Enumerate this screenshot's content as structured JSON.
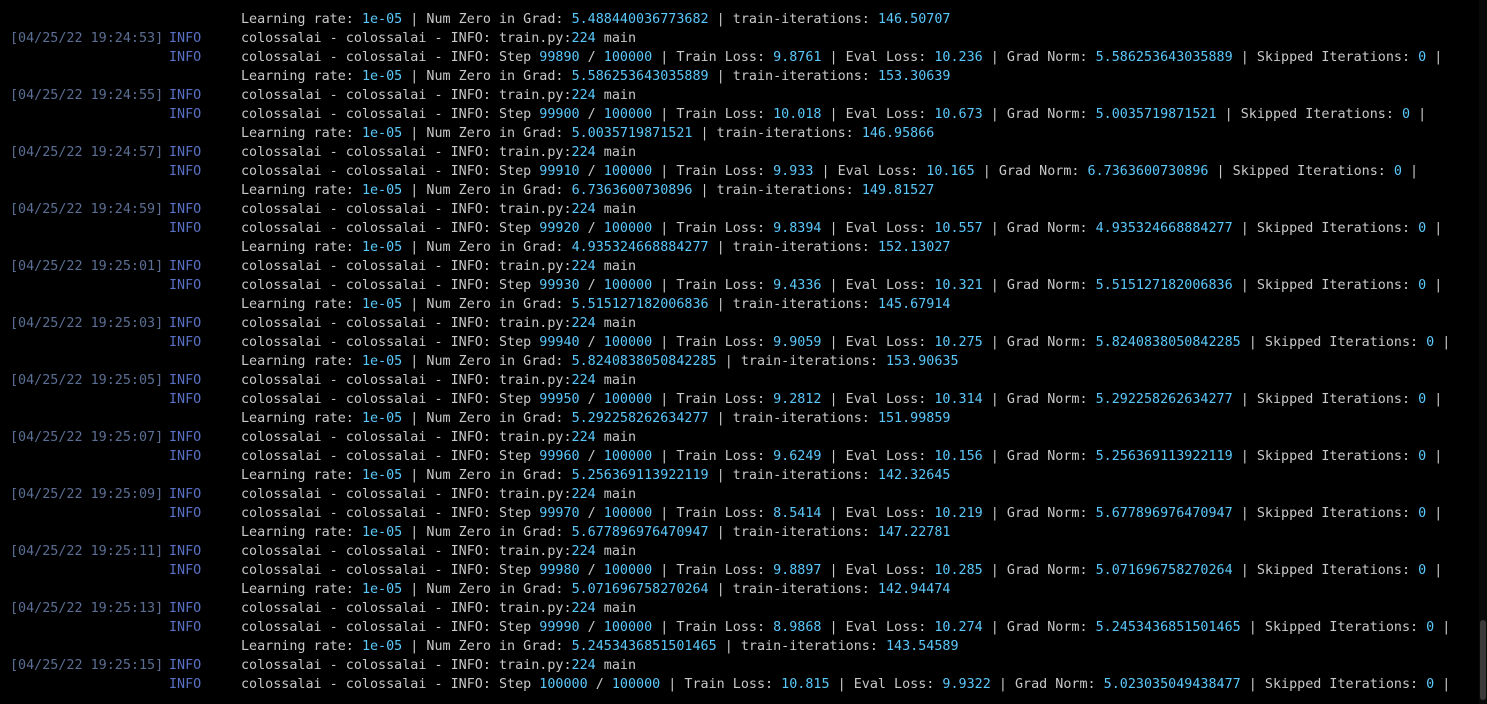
{
  "colors": {
    "background": "#000000",
    "text": "#c8c8c8",
    "timestamp": "#5b6e93",
    "level": "#5870c4",
    "number": "#5ac8fa"
  },
  "lines": [
    {
      "ts": "",
      "level": "",
      "segments": [
        [
          "Learning rate: ",
          false
        ],
        [
          "1e-05",
          true
        ],
        [
          " | Num Zero in Grad: ",
          false
        ],
        [
          "5.488440036773682",
          true
        ],
        [
          " | train-iterations: ",
          false
        ],
        [
          "146.50707",
          true
        ]
      ]
    },
    {
      "ts": "[04/25/22 19:24:53]",
      "level": "INFO",
      "segments": [
        [
          "colossalai - colossalai - INFO: train.py:",
          false
        ],
        [
          "224",
          true
        ],
        [
          " main",
          false
        ]
      ]
    },
    {
      "ts": "",
      "level": "INFO",
      "segments": [
        [
          "colossalai - colossalai - INFO: Step ",
          false
        ],
        [
          "99890",
          true
        ],
        [
          " / ",
          false
        ],
        [
          "100000",
          true
        ],
        [
          " | Train Loss: ",
          false
        ],
        [
          "9.8761",
          true
        ],
        [
          " | Eval Loss: ",
          false
        ],
        [
          "10.236",
          true
        ],
        [
          " | Grad Norm: ",
          false
        ],
        [
          "5.586253643035889",
          true
        ],
        [
          " | Skipped Iterations: ",
          false
        ],
        [
          "0",
          true
        ],
        [
          " |",
          false
        ]
      ]
    },
    {
      "ts": "",
      "level": "",
      "segments": [
        [
          "Learning rate: ",
          false
        ],
        [
          "1e-05",
          true
        ],
        [
          " | Num Zero in Grad: ",
          false
        ],
        [
          "5.586253643035889",
          true
        ],
        [
          " | train-iterations: ",
          false
        ],
        [
          "153.30639",
          true
        ]
      ]
    },
    {
      "ts": "[04/25/22 19:24:55]",
      "level": "INFO",
      "segments": [
        [
          "colossalai - colossalai - INFO: train.py:",
          false
        ],
        [
          "224",
          true
        ],
        [
          " main",
          false
        ]
      ]
    },
    {
      "ts": "",
      "level": "INFO",
      "segments": [
        [
          "colossalai - colossalai - INFO: Step ",
          false
        ],
        [
          "99900",
          true
        ],
        [
          " / ",
          false
        ],
        [
          "100000",
          true
        ],
        [
          " | Train Loss: ",
          false
        ],
        [
          "10.018",
          true
        ],
        [
          " | Eval Loss: ",
          false
        ],
        [
          "10.673",
          true
        ],
        [
          " | Grad Norm: ",
          false
        ],
        [
          "5.0035719871521",
          true
        ],
        [
          " | Skipped Iterations: ",
          false
        ],
        [
          "0",
          true
        ],
        [
          " |",
          false
        ]
      ]
    },
    {
      "ts": "",
      "level": "",
      "segments": [
        [
          "Learning rate: ",
          false
        ],
        [
          "1e-05",
          true
        ],
        [
          " | Num Zero in Grad: ",
          false
        ],
        [
          "5.0035719871521",
          true
        ],
        [
          " | train-iterations: ",
          false
        ],
        [
          "146.95866",
          true
        ]
      ]
    },
    {
      "ts": "[04/25/22 19:24:57]",
      "level": "INFO",
      "segments": [
        [
          "colossalai - colossalai - INFO: train.py:",
          false
        ],
        [
          "224",
          true
        ],
        [
          " main",
          false
        ]
      ]
    },
    {
      "ts": "",
      "level": "INFO",
      "segments": [
        [
          "colossalai - colossalai - INFO: Step ",
          false
        ],
        [
          "99910",
          true
        ],
        [
          " / ",
          false
        ],
        [
          "100000",
          true
        ],
        [
          " | Train Loss: ",
          false
        ],
        [
          "9.933",
          true
        ],
        [
          " | Eval Loss: ",
          false
        ],
        [
          "10.165",
          true
        ],
        [
          " | Grad Norm: ",
          false
        ],
        [
          "6.7363600730896",
          true
        ],
        [
          " | Skipped Iterations: ",
          false
        ],
        [
          "0",
          true
        ],
        [
          " |",
          false
        ]
      ]
    },
    {
      "ts": "",
      "level": "",
      "segments": [
        [
          "Learning rate: ",
          false
        ],
        [
          "1e-05",
          true
        ],
        [
          " | Num Zero in Grad: ",
          false
        ],
        [
          "6.7363600730896",
          true
        ],
        [
          " | train-iterations: ",
          false
        ],
        [
          "149.81527",
          true
        ]
      ]
    },
    {
      "ts": "[04/25/22 19:24:59]",
      "level": "INFO",
      "segments": [
        [
          "colossalai - colossalai - INFO: train.py:",
          false
        ],
        [
          "224",
          true
        ],
        [
          " main",
          false
        ]
      ]
    },
    {
      "ts": "",
      "level": "INFO",
      "segments": [
        [
          "colossalai - colossalai - INFO: Step ",
          false
        ],
        [
          "99920",
          true
        ],
        [
          " / ",
          false
        ],
        [
          "100000",
          true
        ],
        [
          " | Train Loss: ",
          false
        ],
        [
          "9.8394",
          true
        ],
        [
          " | Eval Loss: ",
          false
        ],
        [
          "10.557",
          true
        ],
        [
          " | Grad Norm: ",
          false
        ],
        [
          "4.935324668884277",
          true
        ],
        [
          " | Skipped Iterations: ",
          false
        ],
        [
          "0",
          true
        ],
        [
          " |",
          false
        ]
      ]
    },
    {
      "ts": "",
      "level": "",
      "segments": [
        [
          "Learning rate: ",
          false
        ],
        [
          "1e-05",
          true
        ],
        [
          " | Num Zero in Grad: ",
          false
        ],
        [
          "4.935324668884277",
          true
        ],
        [
          " | train-iterations: ",
          false
        ],
        [
          "152.13027",
          true
        ]
      ]
    },
    {
      "ts": "[04/25/22 19:25:01]",
      "level": "INFO",
      "segments": [
        [
          "colossalai - colossalai - INFO: train.py:",
          false
        ],
        [
          "224",
          true
        ],
        [
          " main",
          false
        ]
      ]
    },
    {
      "ts": "",
      "level": "INFO",
      "segments": [
        [
          "colossalai - colossalai - INFO: Step ",
          false
        ],
        [
          "99930",
          true
        ],
        [
          " / ",
          false
        ],
        [
          "100000",
          true
        ],
        [
          " | Train Loss: ",
          false
        ],
        [
          "9.4336",
          true
        ],
        [
          " | Eval Loss: ",
          false
        ],
        [
          "10.321",
          true
        ],
        [
          " | Grad Norm: ",
          false
        ],
        [
          "5.515127182006836",
          true
        ],
        [
          " | Skipped Iterations: ",
          false
        ],
        [
          "0",
          true
        ],
        [
          " |",
          false
        ]
      ]
    },
    {
      "ts": "",
      "level": "",
      "segments": [
        [
          "Learning rate: ",
          false
        ],
        [
          "1e-05",
          true
        ],
        [
          " | Num Zero in Grad: ",
          false
        ],
        [
          "5.515127182006836",
          true
        ],
        [
          " | train-iterations: ",
          false
        ],
        [
          "145.67914",
          true
        ]
      ]
    },
    {
      "ts": "[04/25/22 19:25:03]",
      "level": "INFO",
      "segments": [
        [
          "colossalai - colossalai - INFO: train.py:",
          false
        ],
        [
          "224",
          true
        ],
        [
          " main",
          false
        ]
      ]
    },
    {
      "ts": "",
      "level": "INFO",
      "segments": [
        [
          "colossalai - colossalai - INFO: Step ",
          false
        ],
        [
          "99940",
          true
        ],
        [
          " / ",
          false
        ],
        [
          "100000",
          true
        ],
        [
          " | Train Loss: ",
          false
        ],
        [
          "9.9059",
          true
        ],
        [
          " | Eval Loss: ",
          false
        ],
        [
          "10.275",
          true
        ],
        [
          " | Grad Norm: ",
          false
        ],
        [
          "5.8240838050842285",
          true
        ],
        [
          " | Skipped Iterations: ",
          false
        ],
        [
          "0",
          true
        ],
        [
          " |",
          false
        ]
      ]
    },
    {
      "ts": "",
      "level": "",
      "segments": [
        [
          "Learning rate: ",
          false
        ],
        [
          "1e-05",
          true
        ],
        [
          " | Num Zero in Grad: ",
          false
        ],
        [
          "5.8240838050842285",
          true
        ],
        [
          " | train-iterations: ",
          false
        ],
        [
          "153.90635",
          true
        ]
      ]
    },
    {
      "ts": "[04/25/22 19:25:05]",
      "level": "INFO",
      "segments": [
        [
          "colossalai - colossalai - INFO: train.py:",
          false
        ],
        [
          "224",
          true
        ],
        [
          " main",
          false
        ]
      ]
    },
    {
      "ts": "",
      "level": "INFO",
      "segments": [
        [
          "colossalai - colossalai - INFO: Step ",
          false
        ],
        [
          "99950",
          true
        ],
        [
          " / ",
          false
        ],
        [
          "100000",
          true
        ],
        [
          " | Train Loss: ",
          false
        ],
        [
          "9.2812",
          true
        ],
        [
          " | Eval Loss: ",
          false
        ],
        [
          "10.314",
          true
        ],
        [
          " | Grad Norm: ",
          false
        ],
        [
          "5.292258262634277",
          true
        ],
        [
          " | Skipped Iterations: ",
          false
        ],
        [
          "0",
          true
        ],
        [
          " |",
          false
        ]
      ]
    },
    {
      "ts": "",
      "level": "",
      "segments": [
        [
          "Learning rate: ",
          false
        ],
        [
          "1e-05",
          true
        ],
        [
          " | Num Zero in Grad: ",
          false
        ],
        [
          "5.292258262634277",
          true
        ],
        [
          " | train-iterations: ",
          false
        ],
        [
          "151.99859",
          true
        ]
      ]
    },
    {
      "ts": "[04/25/22 19:25:07]",
      "level": "INFO",
      "segments": [
        [
          "colossalai - colossalai - INFO: train.py:",
          false
        ],
        [
          "224",
          true
        ],
        [
          " main",
          false
        ]
      ]
    },
    {
      "ts": "",
      "level": "INFO",
      "segments": [
        [
          "colossalai - colossalai - INFO: Step ",
          false
        ],
        [
          "99960",
          true
        ],
        [
          " / ",
          false
        ],
        [
          "100000",
          true
        ],
        [
          " | Train Loss: ",
          false
        ],
        [
          "9.6249",
          true
        ],
        [
          " | Eval Loss: ",
          false
        ],
        [
          "10.156",
          true
        ],
        [
          " | Grad Norm: ",
          false
        ],
        [
          "5.256369113922119",
          true
        ],
        [
          " | Skipped Iterations: ",
          false
        ],
        [
          "0",
          true
        ],
        [
          " |",
          false
        ]
      ]
    },
    {
      "ts": "",
      "level": "",
      "segments": [
        [
          "Learning rate: ",
          false
        ],
        [
          "1e-05",
          true
        ],
        [
          " | Num Zero in Grad: ",
          false
        ],
        [
          "5.256369113922119",
          true
        ],
        [
          " | train-iterations: ",
          false
        ],
        [
          "142.32645",
          true
        ]
      ]
    },
    {
      "ts": "[04/25/22 19:25:09]",
      "level": "INFO",
      "segments": [
        [
          "colossalai - colossalai - INFO: train.py:",
          false
        ],
        [
          "224",
          true
        ],
        [
          " main",
          false
        ]
      ]
    },
    {
      "ts": "",
      "level": "INFO",
      "segments": [
        [
          "colossalai - colossalai - INFO: Step ",
          false
        ],
        [
          "99970",
          true
        ],
        [
          " / ",
          false
        ],
        [
          "100000",
          true
        ],
        [
          " | Train Loss: ",
          false
        ],
        [
          "8.5414",
          true
        ],
        [
          " | Eval Loss: ",
          false
        ],
        [
          "10.219",
          true
        ],
        [
          " | Grad Norm: ",
          false
        ],
        [
          "5.677896976470947",
          true
        ],
        [
          " | Skipped Iterations: ",
          false
        ],
        [
          "0",
          true
        ],
        [
          " |",
          false
        ]
      ]
    },
    {
      "ts": "",
      "level": "",
      "segments": [
        [
          "Learning rate: ",
          false
        ],
        [
          "1e-05",
          true
        ],
        [
          " | Num Zero in Grad: ",
          false
        ],
        [
          "5.677896976470947",
          true
        ],
        [
          " | train-iterations: ",
          false
        ],
        [
          "147.22781",
          true
        ]
      ]
    },
    {
      "ts": "[04/25/22 19:25:11]",
      "level": "INFO",
      "segments": [
        [
          "colossalai - colossalai - INFO: train.py:",
          false
        ],
        [
          "224",
          true
        ],
        [
          " main",
          false
        ]
      ]
    },
    {
      "ts": "",
      "level": "INFO",
      "segments": [
        [
          "colossalai - colossalai - INFO: Step ",
          false
        ],
        [
          "99980",
          true
        ],
        [
          " / ",
          false
        ],
        [
          "100000",
          true
        ],
        [
          " | Train Loss: ",
          false
        ],
        [
          "9.8897",
          true
        ],
        [
          " | Eval Loss: ",
          false
        ],
        [
          "10.285",
          true
        ],
        [
          " | Grad Norm: ",
          false
        ],
        [
          "5.071696758270264",
          true
        ],
        [
          " | Skipped Iterations: ",
          false
        ],
        [
          "0",
          true
        ],
        [
          " |",
          false
        ]
      ]
    },
    {
      "ts": "",
      "level": "",
      "segments": [
        [
          "Learning rate: ",
          false
        ],
        [
          "1e-05",
          true
        ],
        [
          " | Num Zero in Grad: ",
          false
        ],
        [
          "5.071696758270264",
          true
        ],
        [
          " | train-iterations: ",
          false
        ],
        [
          "142.94474",
          true
        ]
      ]
    },
    {
      "ts": "[04/25/22 19:25:13]",
      "level": "INFO",
      "segments": [
        [
          "colossalai - colossalai - INFO: train.py:",
          false
        ],
        [
          "224",
          true
        ],
        [
          " main",
          false
        ]
      ]
    },
    {
      "ts": "",
      "level": "INFO",
      "segments": [
        [
          "colossalai - colossalai - INFO: Step ",
          false
        ],
        [
          "99990",
          true
        ],
        [
          " / ",
          false
        ],
        [
          "100000",
          true
        ],
        [
          " | Train Loss: ",
          false
        ],
        [
          "8.9868",
          true
        ],
        [
          " | Eval Loss: ",
          false
        ],
        [
          "10.274",
          true
        ],
        [
          " | Grad Norm: ",
          false
        ],
        [
          "5.2453436851501465",
          true
        ],
        [
          " | Skipped Iterations: ",
          false
        ],
        [
          "0",
          true
        ],
        [
          " |",
          false
        ]
      ]
    },
    {
      "ts": "",
      "level": "",
      "segments": [
        [
          "Learning rate: ",
          false
        ],
        [
          "1e-05",
          true
        ],
        [
          " | Num Zero in Grad: ",
          false
        ],
        [
          "5.2453436851501465",
          true
        ],
        [
          " | train-iterations: ",
          false
        ],
        [
          "143.54589",
          true
        ]
      ]
    },
    {
      "ts": "[04/25/22 19:25:15]",
      "level": "INFO",
      "segments": [
        [
          "colossalai - colossalai - INFO: train.py:",
          false
        ],
        [
          "224",
          true
        ],
        [
          " main",
          false
        ]
      ]
    },
    {
      "ts": "",
      "level": "INFO",
      "segments": [
        [
          "colossalai - colossalai - INFO: Step ",
          false
        ],
        [
          "100000",
          true
        ],
        [
          " / ",
          false
        ],
        [
          "100000",
          true
        ],
        [
          " | Train Loss: ",
          false
        ],
        [
          "10.815",
          true
        ],
        [
          " | Eval Loss: ",
          false
        ],
        [
          "9.9322",
          true
        ],
        [
          " | Grad Norm: ",
          false
        ],
        [
          "5.023035049438477",
          true
        ],
        [
          " | Skipped Iterations: ",
          false
        ],
        [
          "0",
          true
        ],
        [
          " |",
          false
        ]
      ]
    }
  ]
}
